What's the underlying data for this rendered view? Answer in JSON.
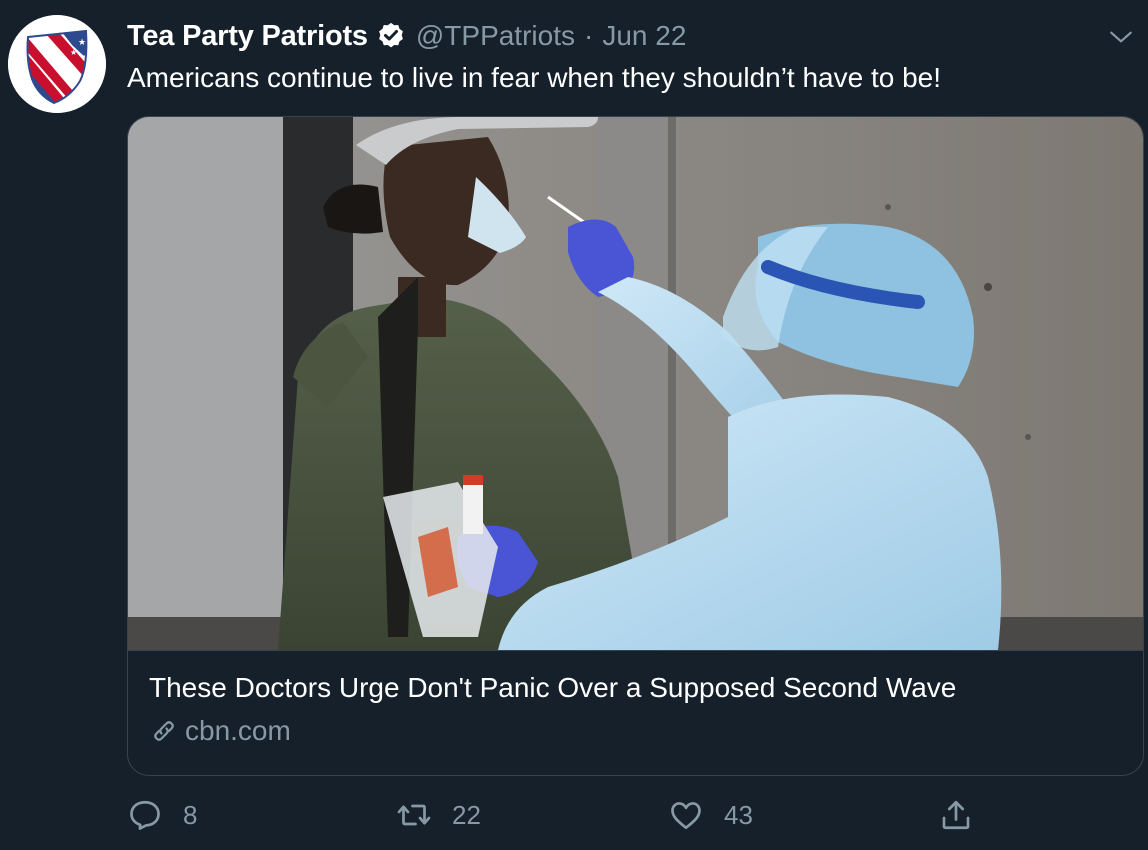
{
  "author": {
    "name": "Tea Party Patriots",
    "handle": "@TPPatriots",
    "separator": "·",
    "date": "Jun 22",
    "verified": true,
    "avatar_icon": "shield-flag-logo"
  },
  "tweet": {
    "text": "Americans continue to live in fear when they shouldn’t have to be!"
  },
  "card": {
    "title": "These Doctors Urge Don't Panic Over a Supposed Second Wave",
    "domain": "cbn.com",
    "image_icon": "news-photo"
  },
  "actions": {
    "reply_count": "8",
    "retweet_count": "22",
    "like_count": "43"
  },
  "colors": {
    "background": "#15202b",
    "secondary_text": "#8899a6",
    "border": "#38444d"
  }
}
